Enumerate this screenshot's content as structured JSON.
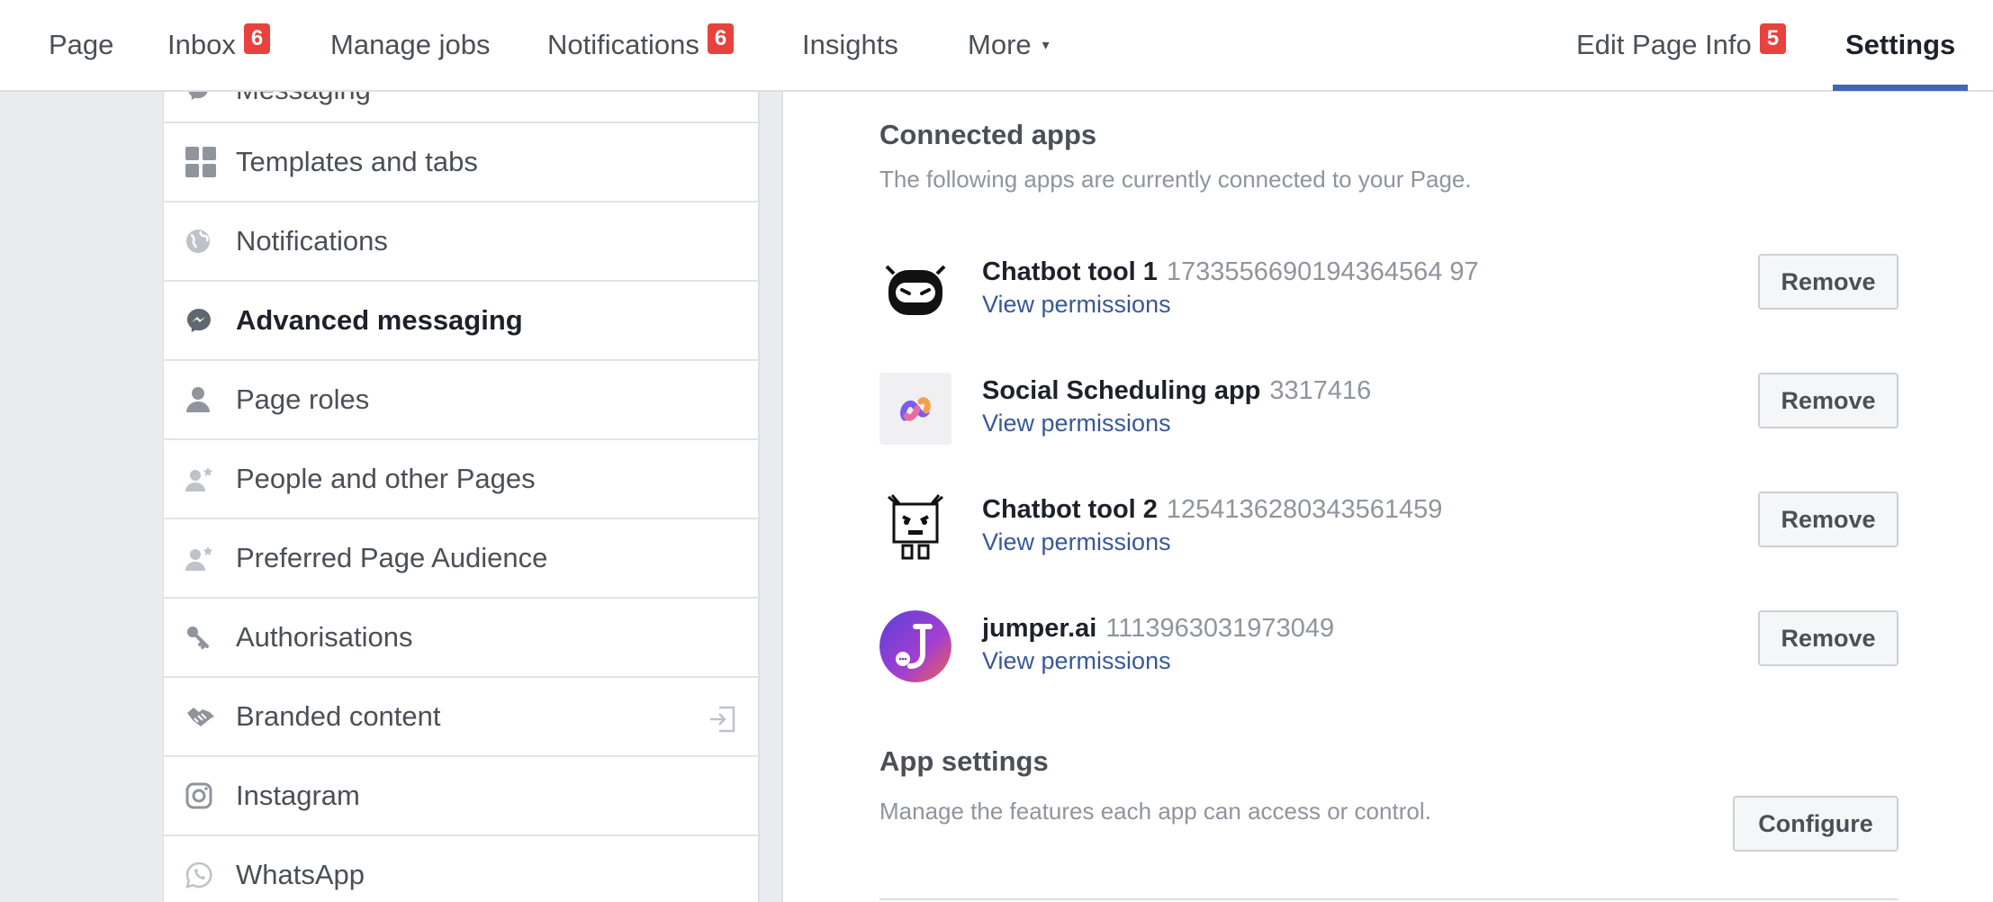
{
  "nav": {
    "items": [
      {
        "label": "Page"
      },
      {
        "label": "Inbox",
        "badge": "6"
      },
      {
        "label": "Manage jobs"
      },
      {
        "label": "Notifications",
        "badge": "6"
      },
      {
        "label": "Insights"
      },
      {
        "label": "More",
        "caret": "▾"
      },
      {
        "label": "Edit Page Info",
        "badge": "5"
      },
      {
        "label": "Settings"
      }
    ],
    "active": "Settings",
    "accent_color": "#4267b2",
    "badge_color": "#e9413e"
  },
  "sidebar": {
    "partial_top_label": "Messaging",
    "items": [
      {
        "label": "Templates and tabs",
        "icon": "templates-grid-icon"
      },
      {
        "label": "Notifications",
        "icon": "globe-icon"
      },
      {
        "label": "Advanced messaging",
        "icon": "messenger-icon",
        "active": true
      },
      {
        "label": "Page roles",
        "icon": "person-icon"
      },
      {
        "label": "People and other Pages",
        "icon": "person-star-icon"
      },
      {
        "label": "Preferred Page Audience",
        "icon": "person-star-icon"
      },
      {
        "label": "Authorisations",
        "icon": "key-icon"
      },
      {
        "label": "Branded content",
        "icon": "handshake-icon",
        "trailing_icon": "exit-icon"
      },
      {
        "label": "Instagram",
        "icon": "instagram-icon"
      },
      {
        "label": "WhatsApp",
        "icon": "whatsapp-icon"
      }
    ]
  },
  "connected_apps": {
    "title": "Connected apps",
    "description": "The following apps are currently connected to your Page.",
    "apps": [
      {
        "name": "Chatbot tool 1",
        "id": "1733556690194364564 97",
        "permissions_label": "View permissions",
        "remove_label": "Remove",
        "logo": "robot-head-icon"
      },
      {
        "name": "Social Scheduling app",
        "id": "3317416",
        "permissions_label": "View permissions",
        "remove_label": "Remove",
        "logo": "scheduling-logo-icon"
      },
      {
        "name": "Chatbot tool 2",
        "id": "1254136280343561459",
        "permissions_label": "View permissions",
        "remove_label": "Remove",
        "logo": "box-robot-icon"
      },
      {
        "name": "jumper.ai",
        "id": "1113963031973049",
        "permissions_label": "View permissions",
        "remove_label": "Remove",
        "logo": "jumper-logo-icon"
      }
    ]
  },
  "app_settings": {
    "title": "App settings",
    "description": "Manage the features each app can access or control.",
    "configure_label": "Configure"
  }
}
